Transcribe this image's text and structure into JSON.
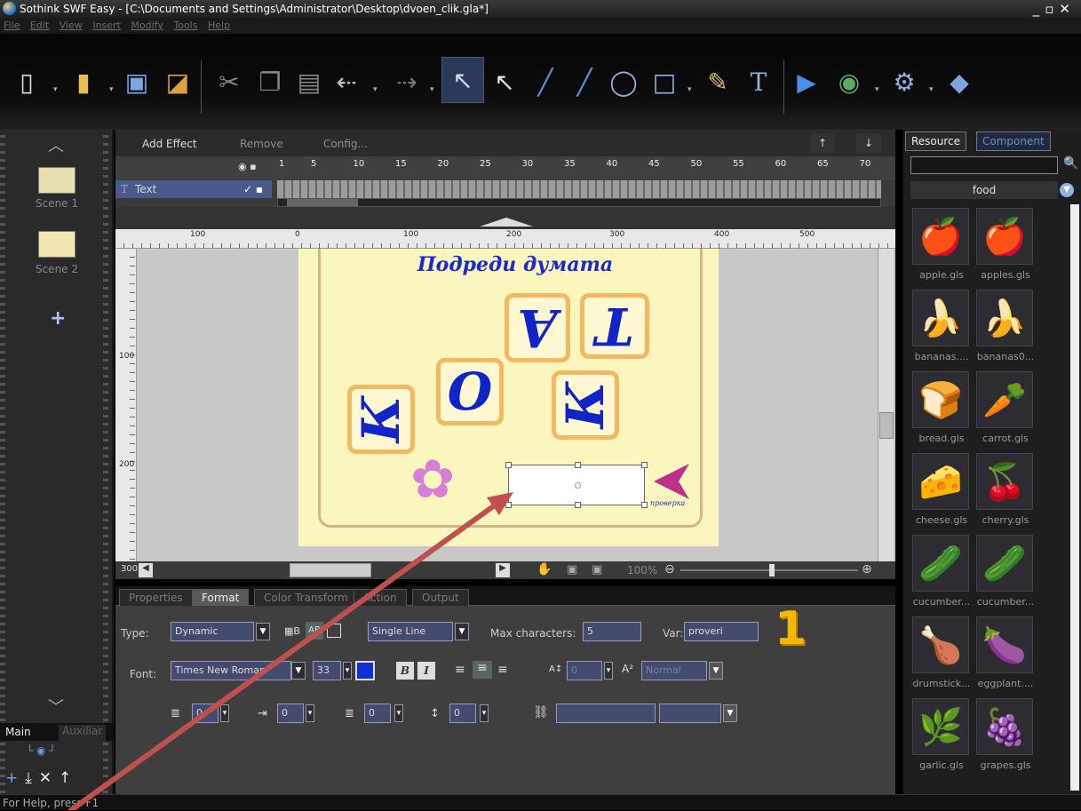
{
  "window": {
    "title": "Sothink SWF Easy - [C:\\Documents and Settings\\Administrator\\Desktop\\dvoen_clik.gla*]"
  },
  "menu": [
    "File",
    "Edit",
    "View",
    "Insert",
    "Modify",
    "Tools",
    "Help"
  ],
  "scenes": [
    {
      "label": "Scene 1"
    },
    {
      "label": "Scene 2"
    }
  ],
  "left_tabs": {
    "main": "Main",
    "aux": "Auxiliar"
  },
  "timeline": {
    "add_effect": "Add Effect",
    "remove": "Remove",
    "config": "Config...",
    "ruler": [
      "1",
      "5",
      "10",
      "15",
      "20",
      "25",
      "30",
      "35",
      "40",
      "45",
      "50",
      "55",
      "60",
      "65",
      "70"
    ],
    "layer": "Text"
  },
  "stage_ruler_h": [
    "100",
    "0",
    "100",
    "200",
    "300",
    "400",
    "500"
  ],
  "stage_ruler_v": [
    "100",
    "200",
    "300"
  ],
  "canvas": {
    "title": "Подреди думата",
    "tiles": [
      "К",
      "О",
      "А",
      "Т",
      "К"
    ],
    "button_label": "проверка"
  },
  "zoom": "100%",
  "prop_tabs": [
    "Properties",
    "Format",
    "Color Transform",
    "Action",
    "Output"
  ],
  "props": {
    "type_label": "Type:",
    "type_value": "Dynamic",
    "line_value": "Single Line",
    "max_chars_label": "Max characters:",
    "max_chars_value": "5",
    "var_label": "Var:",
    "var_value": "proveri",
    "font_label": "Font:",
    "font_value": "Times New Roman",
    "font_size": "33",
    "bold": "B",
    "italic": "I",
    "spacing_value": "0",
    "super_value": "Normal",
    "indent1": "0",
    "indent2": "0",
    "indent3": "0",
    "indent4": "0"
  },
  "callout_number": "1",
  "resource": {
    "tab_resource": "Resource",
    "tab_component": "Component",
    "category": "food",
    "items": [
      {
        "label": "apple.gls",
        "icon": "🍎"
      },
      {
        "label": "apples.gls",
        "icon": "🍎"
      },
      {
        "label": "bananas....",
        "icon": "🍌"
      },
      {
        "label": "bananas0...",
        "icon": "🍌"
      },
      {
        "label": "bread.gls",
        "icon": "🍞"
      },
      {
        "label": "carrot.gls",
        "icon": "🥕"
      },
      {
        "label": "cheese.gls",
        "icon": "🧀"
      },
      {
        "label": "cherry.gls",
        "icon": "🍒"
      },
      {
        "label": "cucumber...",
        "icon": "🥒"
      },
      {
        "label": "cucumber...",
        "icon": "🥒"
      },
      {
        "label": "drumstick...",
        "icon": "🍗"
      },
      {
        "label": "eggplant....",
        "icon": "🍆"
      },
      {
        "label": "garlic.gls",
        "icon": "🌿"
      },
      {
        "label": "grapes.gls",
        "icon": "🍇"
      }
    ]
  },
  "status": "For Help, press F1",
  "colors": {
    "accent": "#1024c8",
    "tile_border": "#f4b860",
    "canvas_bg": "#fbf6bd",
    "arrow": "#c0504d"
  }
}
